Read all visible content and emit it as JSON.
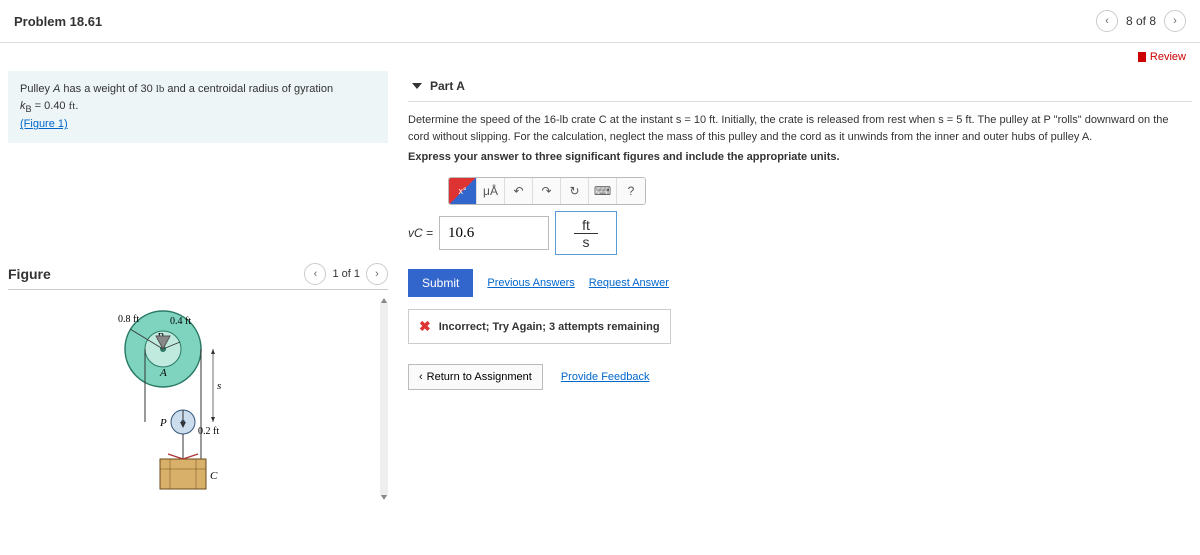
{
  "header": {
    "title": "Problem 18.61",
    "position": "8 of 8"
  },
  "review": "Review",
  "problem": {
    "line1_a": "Pulley ",
    "line1_b": " has a weight of 30 ",
    "line1_c": " and a centroidal radius of gyration",
    "sym_A": "A",
    "unit_lb": "lb",
    "line2_a": "k",
    "line2_b": " = 0.40 ",
    "unit_ft": "ft",
    "fig_link": "(Figure 1)"
  },
  "figure": {
    "title": "Figure",
    "nav": "1 of 1",
    "labels": {
      "r_outer": "0.8 ft",
      "r_inner": "0.4 ft",
      "B": "B",
      "A": "A",
      "P": "P",
      "s": "s",
      "r_p": "0.2 ft",
      "C": "C"
    }
  },
  "part": {
    "title": "Part A",
    "q1": "Determine the speed of the 16-lb crate C at the instant s = 10 ft. Initially, the crate is released from rest when s = 5 ft. The pulley at P \"rolls\" downward on the cord without slipping. For the calculation, neglect the mass of this pulley and the cord as it unwinds from the inner and outer hubs of pulley A.",
    "q2": "Express your answer to three significant figures and include the appropriate units.",
    "toolbar": {
      "tpl": "x°",
      "mu": "μÅ",
      "undo": "↶",
      "redo": "↷",
      "reset": "↻",
      "kbd": "⌨",
      "help": "?"
    },
    "answer": {
      "var": "vC",
      "eq": " = ",
      "value": "10.6",
      "unit_top": "ft",
      "unit_bot": "s"
    },
    "submit": "Submit",
    "prev": "Previous Answers",
    "req": "Request Answer",
    "feedback": "Incorrect; Try Again; 3 attempts remaining"
  },
  "footer": {
    "return": "Return to Assignment",
    "provide": "Provide Feedback"
  }
}
